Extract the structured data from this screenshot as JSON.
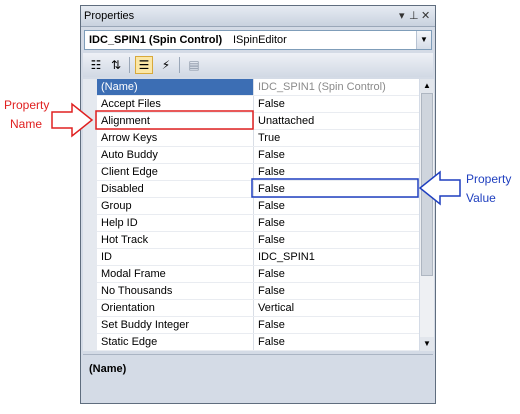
{
  "panel": {
    "title": "Properties",
    "pin_glyph": "▾ 🡅",
    "close_glyph": "✕",
    "object_name": "IDC_SPIN1 (Spin Control)",
    "object_type": "ISpinEditor"
  },
  "properties": [
    {
      "name": "(Name)",
      "value": "IDC_SPIN1 (Spin Control)"
    },
    {
      "name": "Accept Files",
      "value": "False"
    },
    {
      "name": "Alignment",
      "value": "Unattached"
    },
    {
      "name": "Arrow Keys",
      "value": "True"
    },
    {
      "name": "Auto Buddy",
      "value": "False"
    },
    {
      "name": "Client Edge",
      "value": "False"
    },
    {
      "name": "Disabled",
      "value": "False"
    },
    {
      "name": "Group",
      "value": "False"
    },
    {
      "name": "Help ID",
      "value": "False"
    },
    {
      "name": "Hot Track",
      "value": "False"
    },
    {
      "name": "ID",
      "value": "IDC_SPIN1"
    },
    {
      "name": "Modal Frame",
      "value": "False"
    },
    {
      "name": "No Thousands",
      "value": "False"
    },
    {
      "name": "Orientation",
      "value": "Vertical"
    },
    {
      "name": "Set Buddy Integer",
      "value": "False"
    },
    {
      "name": "Static Edge",
      "value": "False"
    }
  ],
  "description": {
    "name": "(Name)"
  },
  "callouts": {
    "name_line1": "Property",
    "name_line2": "Name",
    "value_line1": "Property",
    "value_line2": "Value",
    "name_color": "#e02020",
    "value_color": "#1f3fbf"
  },
  "scrollbar": {
    "thumb_fraction": 0.75
  }
}
